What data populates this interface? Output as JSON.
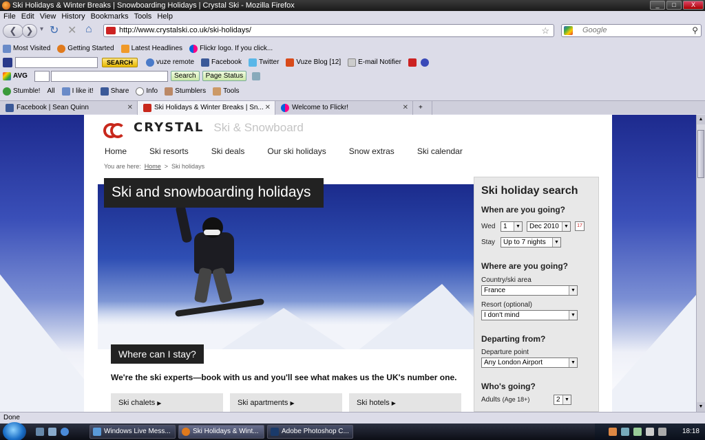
{
  "window": {
    "title": "Ski Holidays & Winter Breaks | Snowboarding Holidays | Crystal Ski - Mozilla Firefox",
    "min": "_",
    "max": "□",
    "close": "X"
  },
  "menu": [
    "File",
    "Edit",
    "View",
    "History",
    "Bookmarks",
    "Tools",
    "Help"
  ],
  "nav": {
    "url": "http://www.crystalski.co.uk/ski-holidays/",
    "search_placeholder": "Google"
  },
  "bookmarks": [
    "Most Visited",
    "Getting Started",
    "Latest Headlines",
    "Flickr logo. If you click..."
  ],
  "toolbar1": {
    "search_btn": "SEARCH",
    "vuze": "vuze remote",
    "facebook": "Facebook",
    "twitter": "Twitter",
    "vuze_blog": "Vuze Blog [12]",
    "email": "E-mail Notifier"
  },
  "toolbar2": {
    "avg": "AVG",
    "search_btn": "Search",
    "page_status": "Page Status"
  },
  "toolbar3": {
    "stumble": "Stumble!",
    "all": "All",
    "ilike": "I like it!",
    "share": "Share",
    "info": "Info",
    "stumblers": "Stumblers",
    "tools": "Tools"
  },
  "tabs": [
    {
      "label": "Facebook | Sean Quinn",
      "color": "#3b5998"
    },
    {
      "label": "Ski Holidays & Winter Breaks | Sn...",
      "color": "#c8281c"
    },
    {
      "label": "Welcome to Flickr!",
      "color": "#ff0084"
    }
  ],
  "site": {
    "logo": "CRYSTAL",
    "tagline": "Ski & Snowboard",
    "nav": [
      "Home",
      "Ski resorts",
      "Ski deals",
      "Our ski holidays",
      "Snow extras",
      "Ski calendar"
    ],
    "crumbs": {
      "prefix": "You are here:",
      "home": "Home",
      "sep": ">",
      "current": "Ski holidays"
    },
    "hero_title": "Ski and snowboarding holidays",
    "where_title": "Where can I stay?",
    "expert_line": "We're the ski experts—book with us and you'll see what makes us the UK's number one.",
    "cards": [
      "Ski chalets",
      "Ski apartments",
      "Ski hotels"
    ]
  },
  "search": {
    "title": "Ski holiday search",
    "when_h": "When are you going?",
    "day_lbl": "Wed",
    "day_val": "1",
    "month_val": "Dec 2010",
    "stay_lbl": "Stay",
    "stay_val": "Up to 7 nights",
    "where_h": "Where are you going?",
    "country_lbl": "Country/ski area",
    "country_val": "France",
    "resort_lbl": "Resort (optional)",
    "resort_val": "I don't mind",
    "depart_h": "Departing from?",
    "depart_lbl": "Departure point",
    "depart_val": "Any London Airport",
    "who_h": "Who's going?",
    "adults_lbl": "Adults",
    "adults_sub": "(Age 18+)",
    "adults_val": "2"
  },
  "status": "Done",
  "taskbar": {
    "items": [
      "Windows Live Mess...",
      "Ski Holidays & Wint...",
      "Adobe Photoshop C..."
    ],
    "clock": "18:18"
  }
}
